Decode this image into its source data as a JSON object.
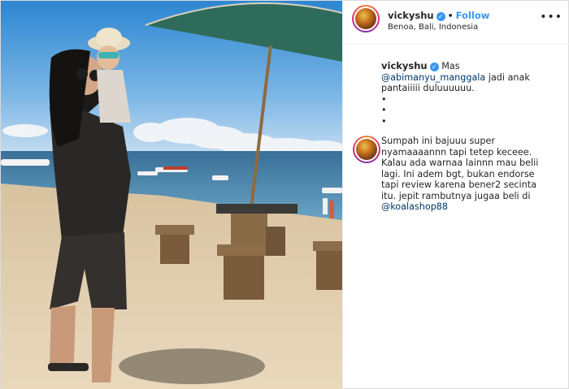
{
  "post": {
    "username": "vickyshu",
    "verified_icon": "verified-badge-icon",
    "separator": "•",
    "follow_label": "Follow",
    "location": "Benoa, Bali, Indonesia",
    "more_icon": "•••"
  },
  "caption": {
    "username": "vickyshu",
    "text_start": "Mas",
    "mention": "@abimanyu_manggala",
    "text_end": "jadi anak pantaiiiii duluuuuuu.",
    "bullets": [
      "•",
      "•",
      "•"
    ]
  },
  "comment": {
    "text": "Sumpah ini bajuuu super nyamaaaannn tapi tetep keceee. Kalau ada warnaa lainnn mau belii lagi. Ini adem bgt, bukan endorse tapi review karena bener2 secinta itu. jepit rambutnya jugaa beli di",
    "mention": "@koalashop88"
  },
  "colors": {
    "link_blue": "#3897f0",
    "mention_blue": "#00376b",
    "text": "#262626"
  }
}
